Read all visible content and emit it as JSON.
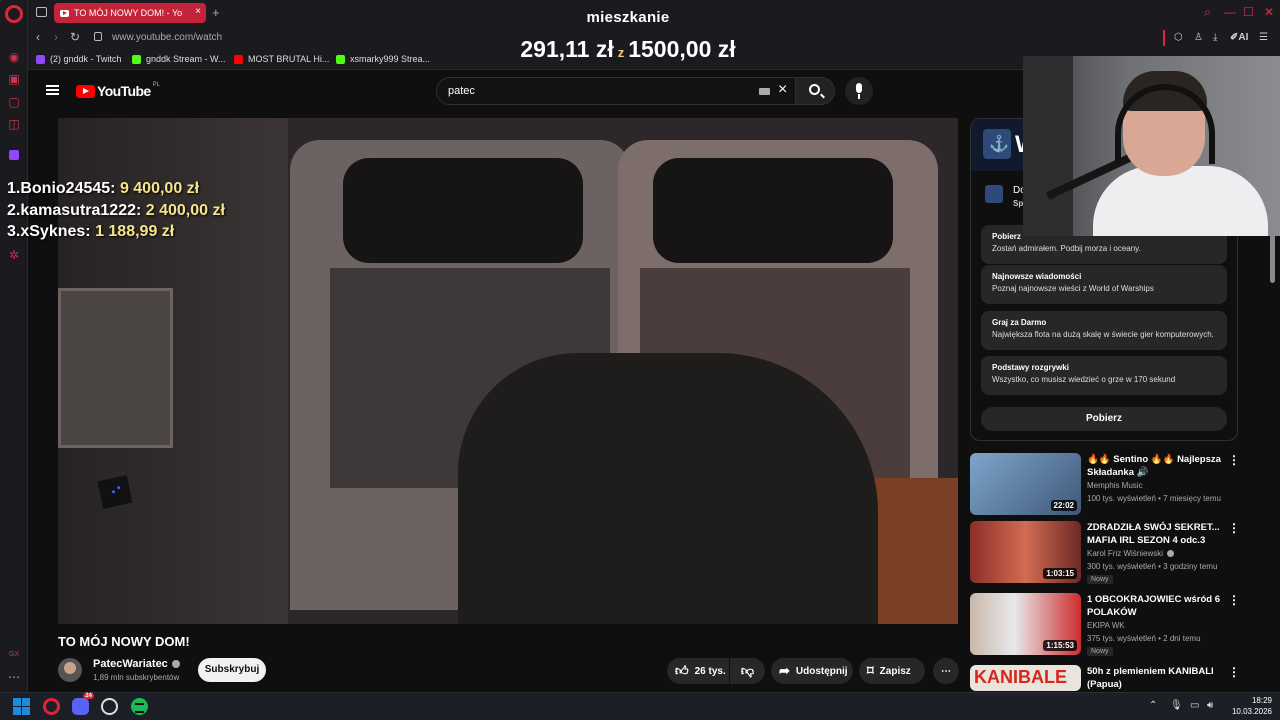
{
  "browser": {
    "tab_title": "TO MÓJ NOWY DOM! - Yo",
    "new_tab": "+",
    "tab_close": "×",
    "url": "www.youtube.com/watch",
    "ai_label": "AI",
    "bookmarks": [
      {
        "label": "(2) gnddk - Twitch",
        "color": "#9146ff"
      },
      {
        "label": "gnddk Stream - W...",
        "color": "#53fc18"
      },
      {
        "label": "MOST BRUTAL Hi...",
        "color": "#ff0000"
      },
      {
        "label": "xsmarky999 Strea...",
        "color": "#53fc18"
      }
    ]
  },
  "overlay": {
    "goal_title": "mieszkanie",
    "current": "291,11 zł",
    "z": "z",
    "target": "1500,00 zł",
    "top_donors": [
      {
        "rank": "1.",
        "name": "Bonio24545:",
        "amount": "9 400,00 zł"
      },
      {
        "rank": "2.",
        "name": "kamasutra1222:",
        "amount": "2 400,00 zł"
      },
      {
        "rank": "3.",
        "name": "xSyknes:",
        "amount": "1 188,99 zł"
      }
    ]
  },
  "youtube": {
    "logo_text": "YouTube",
    "region": "PL",
    "search_query": "patec",
    "video": {
      "title": "TO MÓJ NOWY DOM!",
      "channel": "PatecWariatec",
      "subscribers": "1,89 mln subskrybentów",
      "subscribe_label": "Subskrybuj",
      "likes": "26 tys.",
      "share_label": "Udostępnij",
      "save_label": "Zapisz"
    },
    "ad": {
      "sponsor_line1": "Do",
      "sponsor_line2": "Sp",
      "banner_letter": "W",
      "cards": [
        {
          "title": "Pobierz",
          "desc": "Zostań admirałem. Podbij morza i oceany."
        },
        {
          "title": "Najnowsze wiadomości",
          "desc": "Poznaj najnowsze wieści z World of Warships"
        },
        {
          "title": "Graj za Darmo",
          "desc": "Największa flota na dużą skalę w świecie gier komputerowych."
        },
        {
          "title": "Podstawy rozgrywki",
          "desc": "Wszystko, co musisz wiedzieć o grze w 170 sekund"
        }
      ],
      "cta": "Pobierz"
    },
    "recommendations": [
      {
        "title": "🔥🔥 Sentino 🔥🔥 Najlepsza Składanka 🔊",
        "channel": "Memphis Music",
        "meta": "100 tys. wyświetleń • 7 miesięcy temu",
        "duration": "22:02",
        "badge": "",
        "verified": false,
        "thumb": "#5a7fa8"
      },
      {
        "title": "ZDRADZIŁA SWÓJ SEKRET... MAFIA IRL SEZON 4 odc.3",
        "channel": "Karol Friz Wiśniewski",
        "meta": "300 tys. wyświetleń • 3 godziny temu",
        "duration": "1:03:15",
        "badge": "Nowy",
        "verified": true,
        "thumb": "#a34a3c"
      },
      {
        "title": "1 OBCOKRAJOWIEC wśród 6 POLAKÓW",
        "channel": "EKIPA WK",
        "meta": "375 tys. wyświetleń • 2 dni temu",
        "duration": "1:15:53",
        "badge": "Nowy",
        "verified": false,
        "thumb": "#c9cdd2"
      },
      {
        "title": "50h z plemieniem KANIBALI (Papua)",
        "channel": "",
        "meta": "",
        "duration": "",
        "badge": "",
        "verified": false,
        "thumb": "#d8261e"
      }
    ]
  },
  "taskbar": {
    "discord_badge": "24",
    "time": "18:29",
    "date": "10.03.2026"
  }
}
